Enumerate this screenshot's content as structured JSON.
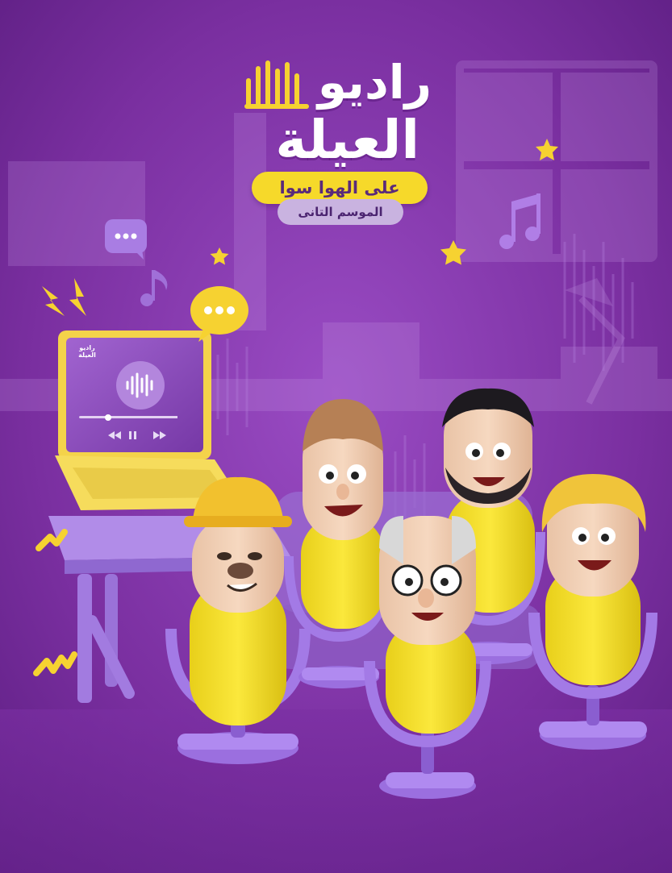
{
  "title": {
    "line1": "راديو",
    "line2": "العيلة"
  },
  "tagline": "على الهوا سوا",
  "season": "الموسم التانى",
  "laptop_screen_logo": {
    "line1": "راديو",
    "line2": "العيلة"
  },
  "colors": {
    "background": "#7a2fa0",
    "accent_yellow": "#f6d92a",
    "accent_lavender": "#a47ad6",
    "mic_base_purple": "#9c6fe0"
  },
  "icons": [
    "speech-bubble-purple-icon",
    "speech-bubble-yellow-icon",
    "music-note-purple-icon",
    "music-note-small-icon",
    "star-icon",
    "lightning-icon",
    "squiggle-icon",
    "audio-wave-icon",
    "play-icon",
    "pause-icon",
    "rewind-icon",
    "fast-forward-icon"
  ],
  "characters": [
    "construction-worker-mic-character",
    "young-man-mic-character",
    "grandfather-mic-character",
    "bearded-man-mic-character",
    "woman-mic-character"
  ]
}
